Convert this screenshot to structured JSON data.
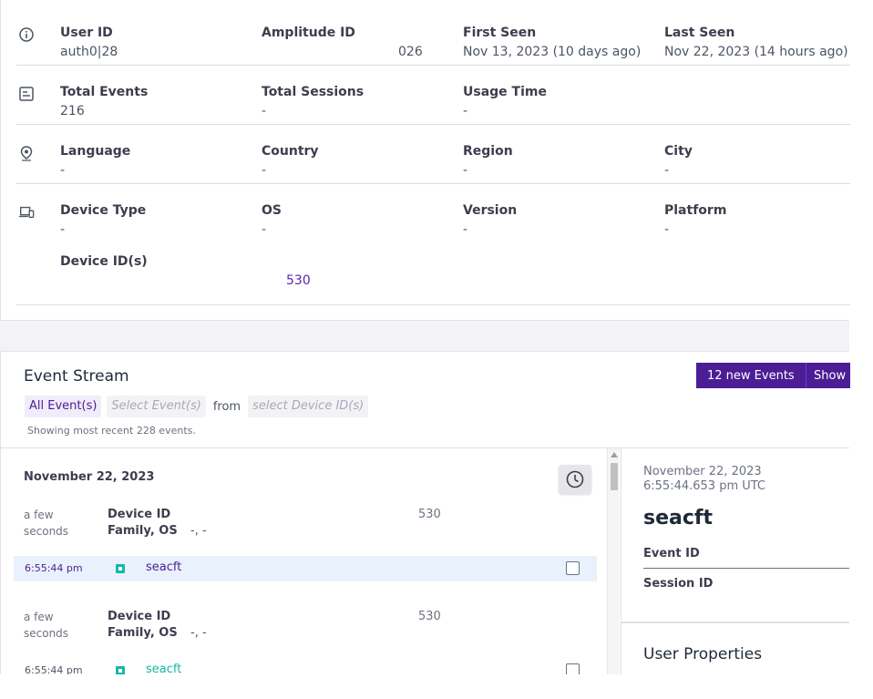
{
  "user_info": {
    "row_identity": {
      "icon": "info-icon",
      "fields": [
        {
          "label": "User ID",
          "value": "auth0|28"
        },
        {
          "label": "Amplitude ID",
          "value": "026"
        },
        {
          "label": "First Seen",
          "value": "Nov 13, 2023 (10 days ago)"
        },
        {
          "label": "Last Seen",
          "value": "Nov 22, 2023 (14 hours ago)"
        }
      ]
    },
    "row_usage": {
      "icon": "calendar-icon",
      "fields": [
        {
          "label": "Total Events",
          "value": "216"
        },
        {
          "label": "Total Sessions",
          "value": "-"
        },
        {
          "label": "Usage Time",
          "value": "-"
        }
      ]
    },
    "row_location": {
      "icon": "location-pin-icon",
      "fields": [
        {
          "label": "Language",
          "value": "-"
        },
        {
          "label": "Country",
          "value": "-"
        },
        {
          "label": "Region",
          "value": "-"
        },
        {
          "label": "City",
          "value": "-"
        }
      ]
    },
    "row_device": {
      "icon": "devices-icon",
      "fields": [
        {
          "label": "Device Type",
          "value": "-"
        },
        {
          "label": "OS",
          "value": "-"
        },
        {
          "label": "Version",
          "value": "-"
        },
        {
          "label": "Platform",
          "value": "-"
        }
      ]
    },
    "device_ids": {
      "label": "Device ID(s)",
      "value": "530"
    }
  },
  "event_stream": {
    "title": "Event Stream",
    "new_events_label": "12 new Events",
    "show_label": "Show",
    "filter_all_events": "All Event(s)",
    "filter_select_events": "Select Event(s)",
    "from_text": "from",
    "filter_select_device": "select Device ID(s)",
    "showing_text": "Showing most recent 228 events.",
    "date_heading": "November 22, 2023",
    "sessions": [
      {
        "time_ago": "a few seconds",
        "device_id_label": "Device ID",
        "family_os_label": "Family, OS",
        "family_os_value": "-, -",
        "device_id_value": "530",
        "event": {
          "time": "6:55:44 pm",
          "name": "seacft",
          "selected": true
        }
      },
      {
        "time_ago": "a few seconds",
        "device_id_label": "Device ID",
        "family_os_label": "Family, OS",
        "family_os_value": "-, -",
        "device_id_value": "530",
        "event": {
          "time": "6:55:44 pm",
          "name": "seacft",
          "selected": false
        }
      }
    ]
  },
  "detail": {
    "date": "November 22, 2023",
    "time": "6:55:44.653 pm UTC",
    "event_name": "seacft",
    "event_id_label": "Event ID",
    "session_id_label": "Session ID",
    "user_properties_label": "User Properties"
  },
  "colors": {
    "brand_purple": "#4c1d95",
    "event_marker_teal": "#14b8a6",
    "selected_row_bg": "#e9f1fc"
  }
}
